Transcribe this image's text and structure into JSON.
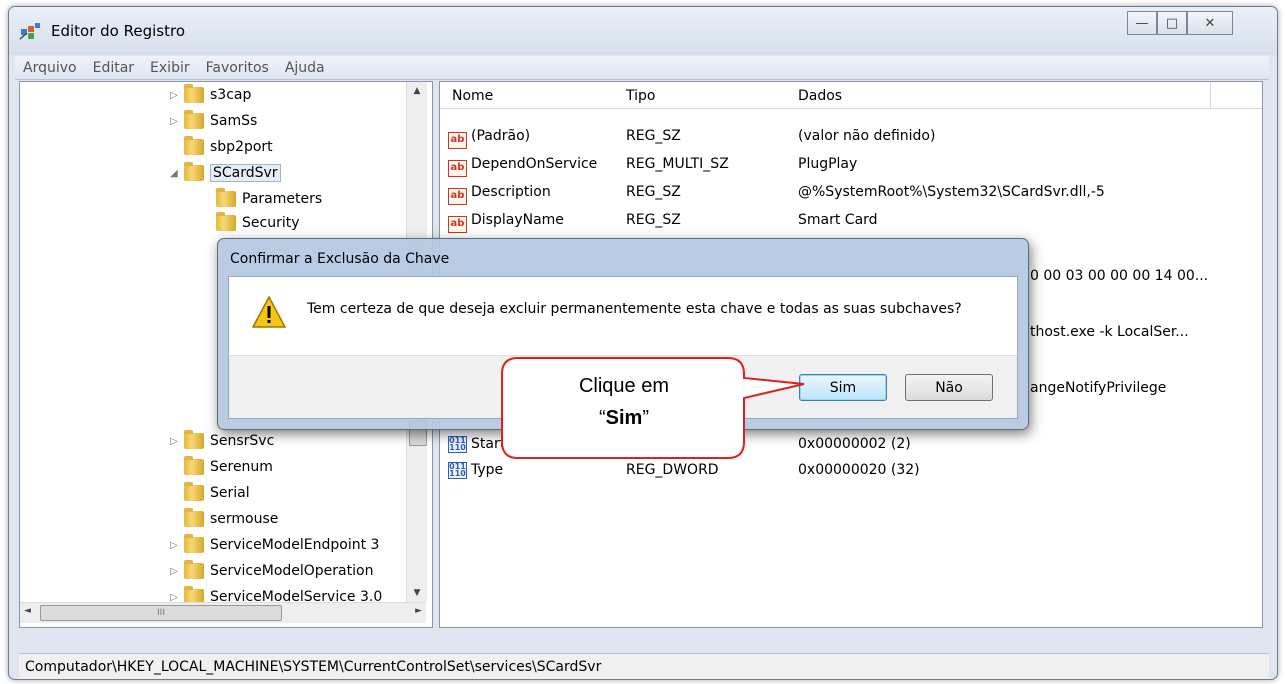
{
  "window": {
    "title": "Editor do Registro",
    "minimize": "—",
    "maximize": "□",
    "close": "✕"
  },
  "menu": [
    "Arquivo",
    "Editar",
    "Exibir",
    "Favoritos",
    "Ajuda"
  ],
  "tree": {
    "items": [
      "s3cap",
      "SamSs",
      "sbp2port",
      "SCardSvr",
      "Parameters",
      "Security",
      "SensrSvc",
      "Serenum",
      "Serial",
      "sermouse",
      "ServiceModelEndpoint 3",
      "ServiceModelOperation",
      "ServiceModelService 3.0"
    ],
    "scroll_left": "◄",
    "scroll_right": "►",
    "scroll_up": "▲",
    "scroll_down": "▼",
    "hscroll_grip": "III"
  },
  "list": {
    "columns": [
      "Nome",
      "Tipo",
      "Dados"
    ],
    "rows": [
      {
        "name": "(Padrão)",
        "type": "REG_SZ",
        "data": "(valor não definido)"
      },
      {
        "name": "DependOnService",
        "type": "REG_MULTI_SZ",
        "data": "PlugPlay"
      },
      {
        "name": "Description",
        "type": "REG_SZ",
        "data": "@%SystemRoot%\\System32\\SCardSvr.dll,-5"
      },
      {
        "name": "DisplayName",
        "type": "REG_SZ",
        "data": "Smart Card"
      },
      {
        "data": "0 00 03 00 00 00 14 00..."
      },
      {
        "data": "thost.exe -k LocalSer..."
      },
      {
        "data": "angeNotifyPrivilege"
      },
      {
        "name": "Start",
        "data": "0x00000002 (2)"
      },
      {
        "name": "Type",
        "type": "REG_DWORD",
        "data": "0x00000020 (32)"
      }
    ]
  },
  "status": "Computador\\HKEY_LOCAL_MACHINE\\SYSTEM\\CurrentControlSet\\services\\SCardSvr",
  "dialog": {
    "title": "Confirmar a Exclusão da Chave",
    "message": "Tem certeza de que deseja excluir permanentemente esta chave e todas as suas subchaves?",
    "yes": "Sim",
    "no": "Não"
  },
  "callout": {
    "line1": "Clique em",
    "quote_open": "“",
    "bold": "Sim",
    "quote_close": "”"
  }
}
